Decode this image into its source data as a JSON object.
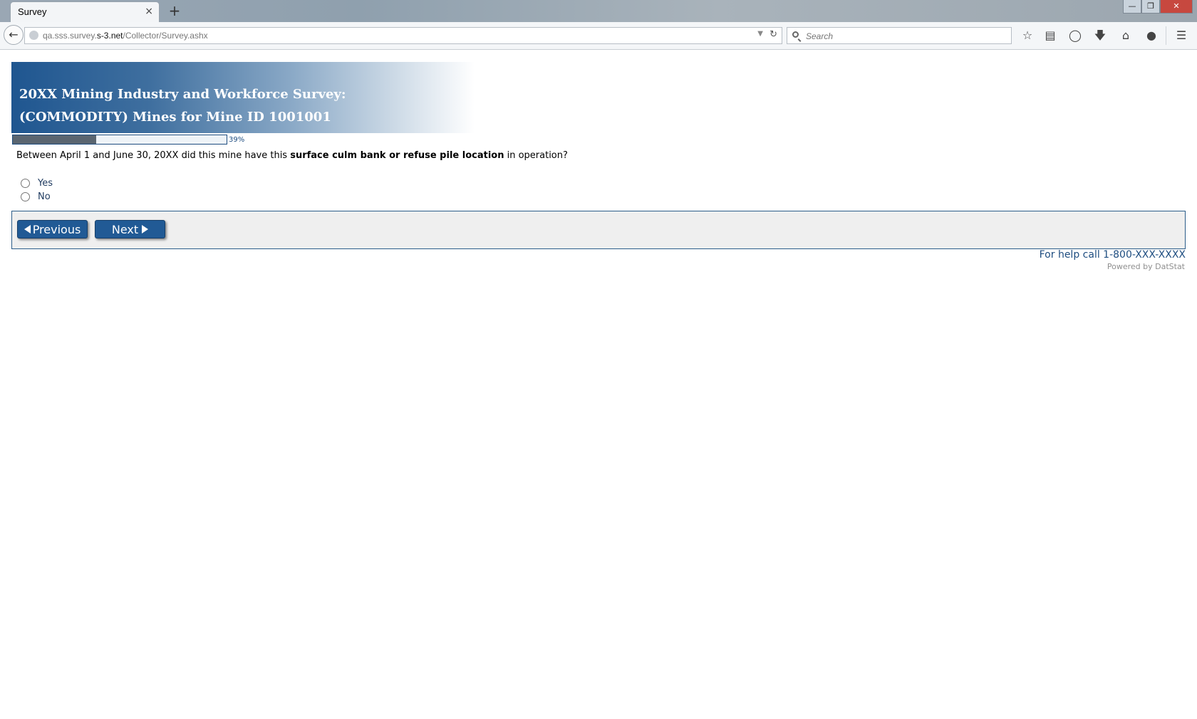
{
  "browser": {
    "tab_title": "Survey",
    "tab_close_icon": "×",
    "new_tab_icon": "+",
    "url_prefix": "qa.sss.survey.",
    "url_domain": "s-3.net",
    "url_path": "/Collector/Survey.ashx",
    "search_placeholder": "Search",
    "window_buttons": {
      "minimize": "—",
      "maximize": "❐",
      "close": "✕"
    },
    "toolbar_icons": [
      "bookmark-star-icon",
      "reading-list-icon",
      "pocket-icon",
      "download-icon",
      "home-icon",
      "chat-icon",
      "menu-icon"
    ]
  },
  "banner": {
    "line1": "20XX Mining Industry and Workforce Survey:",
    "line2": "(COMMODITY) Mines for Mine ID 1001001"
  },
  "progress": {
    "percent": 39,
    "label": "39%"
  },
  "question": {
    "before": "Between April 1 and June 30, 20XX did this mine have this ",
    "bold": "surface culm bank or refuse pile location",
    "after": " in operation?"
  },
  "options": [
    {
      "label": "Yes",
      "selected": false
    },
    {
      "label": "No",
      "selected": false
    }
  ],
  "nav": {
    "previous_label": "Previous",
    "next_label": "Next"
  },
  "footer": {
    "help_text": "For help call 1-800-XXX-XXXX",
    "powered_text": "Powered by DatStat"
  },
  "colors": {
    "brand_blue": "#215a95",
    "progress_fill": "#5a6570",
    "panel_bg": "#efefef"
  }
}
